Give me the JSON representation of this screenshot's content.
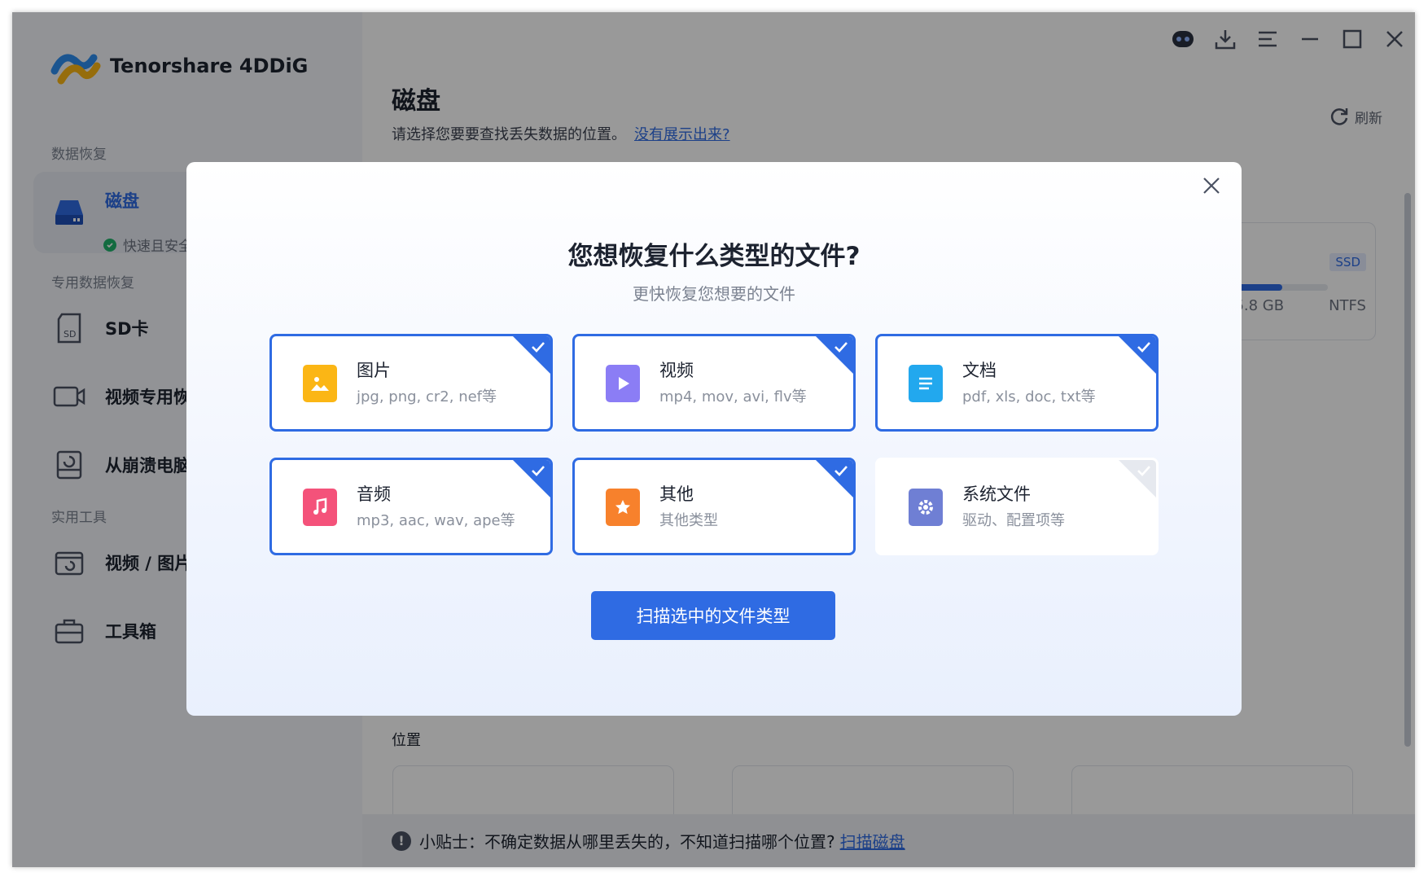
{
  "app": {
    "name": "Tenorshare 4DDiG"
  },
  "sidebar": {
    "sections": [
      {
        "title": "数据恢复"
      },
      {
        "title": "专用数据恢复"
      },
      {
        "title": "实用工具"
      }
    ],
    "items": [
      {
        "label": "磁盘",
        "sub": "快速且安全"
      },
      {
        "label": "SD卡"
      },
      {
        "label": "视频专用恢"
      },
      {
        "label": "从崩溃电脑"
      },
      {
        "label": "视频 / 图片"
      },
      {
        "label": "工具箱"
      }
    ]
  },
  "main": {
    "title": "磁盘",
    "subtitle": "请选择您要要查找丢失数据的位置。",
    "link": "没有展示出来?",
    "refresh": "刷新",
    "disk": {
      "badge": "SSD",
      "size": "35.8 GB",
      "fs": "NTFS",
      "used_fraction": 0.95
    },
    "location_title": "位置",
    "tip": {
      "text": "小贴士：不确定数据从哪里丢失的，不知道扫描哪个位置?",
      "link": "扫描磁盘"
    }
  },
  "modal": {
    "title": "您想恢复什么类型的文件?",
    "subtitle": "更快恢复您想要的文件",
    "file_types": [
      {
        "name": "图片",
        "desc": "jpg, png, cr2, nef等",
        "checked": true,
        "icon": "image-icon",
        "color": "#fbb615"
      },
      {
        "name": "视频",
        "desc": "mp4, mov, avi, flv等",
        "checked": true,
        "icon": "video-play-icon",
        "color": "#8b7df5"
      },
      {
        "name": "文档",
        "desc": "pdf, xls, doc, txt等",
        "checked": true,
        "icon": "document-icon",
        "color": "#22a8ee"
      },
      {
        "name": "音频",
        "desc": "mp3, aac, wav, ape等",
        "checked": true,
        "icon": "music-icon",
        "color": "#f4527a"
      },
      {
        "name": "其他",
        "desc": "其他类型",
        "checked": true,
        "icon": "star-icon",
        "color": "#f7812c"
      },
      {
        "name": "系统文件",
        "desc": "驱动、配置项等",
        "checked": false,
        "icon": "gear-icon",
        "color": "#6f7fd4"
      }
    ],
    "scan_button": "扫描选中的文件类型"
  },
  "colors": {
    "accent": "#2f6be3",
    "text": "#1d2330",
    "muted": "#7b8290"
  }
}
